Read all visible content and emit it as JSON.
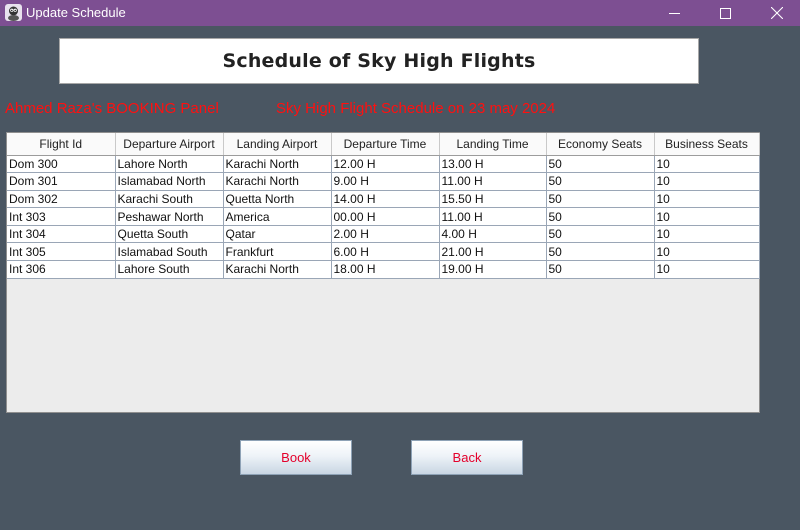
{
  "window": {
    "title": "Update Schedule"
  },
  "heading": "Schedule of Sky High Flights",
  "labels": {
    "panel": "Ahmed Raza's  BOOKING Panel",
    "schedule": "Sky High Flight Schedule on 23 may 2024"
  },
  "table": {
    "columns": [
      "Flight Id",
      "Departure Airport",
      "Landing Airport",
      "Departure Time",
      "Landing Time",
      "Economy Seats",
      "Business Seats"
    ],
    "rows": [
      [
        "Dom 300",
        "Lahore North",
        "Karachi North",
        "12.00 H",
        "13.00 H",
        "50",
        "10"
      ],
      [
        "Dom 301",
        "Islamabad North",
        "Karachi North",
        "9.00 H",
        "11.00 H",
        "50",
        "10"
      ],
      [
        "Dom 302",
        "Karachi South",
        "Quetta North",
        "14.00 H",
        "15.50 H",
        "50",
        "10"
      ],
      [
        "Int 303",
        "Peshawar North",
        "America",
        "00.00 H",
        "11.00 H",
        "50",
        "10"
      ],
      [
        "Int 304",
        "Quetta South",
        "Qatar",
        "2.00 H",
        "4.00 H",
        "50",
        "10"
      ],
      [
        "Int 305",
        "Islamabad South",
        "Frankfurt",
        "6.00 H",
        "21.00 H",
        "50",
        "10"
      ],
      [
        "Int 306",
        "Lahore South",
        "Karachi North",
        "18.00 H",
        "19.00 H",
        "50",
        "10"
      ]
    ]
  },
  "buttons": {
    "book": "Book",
    "back": "Back"
  },
  "icons": {
    "app": "java-duke-icon",
    "minimize": "minimize-icon",
    "maximize": "maximize-icon",
    "close": "close-icon"
  },
  "colors": {
    "titlebar": "#7d4f92",
    "background": "#4a5662",
    "accent_text": "#ff1010"
  }
}
